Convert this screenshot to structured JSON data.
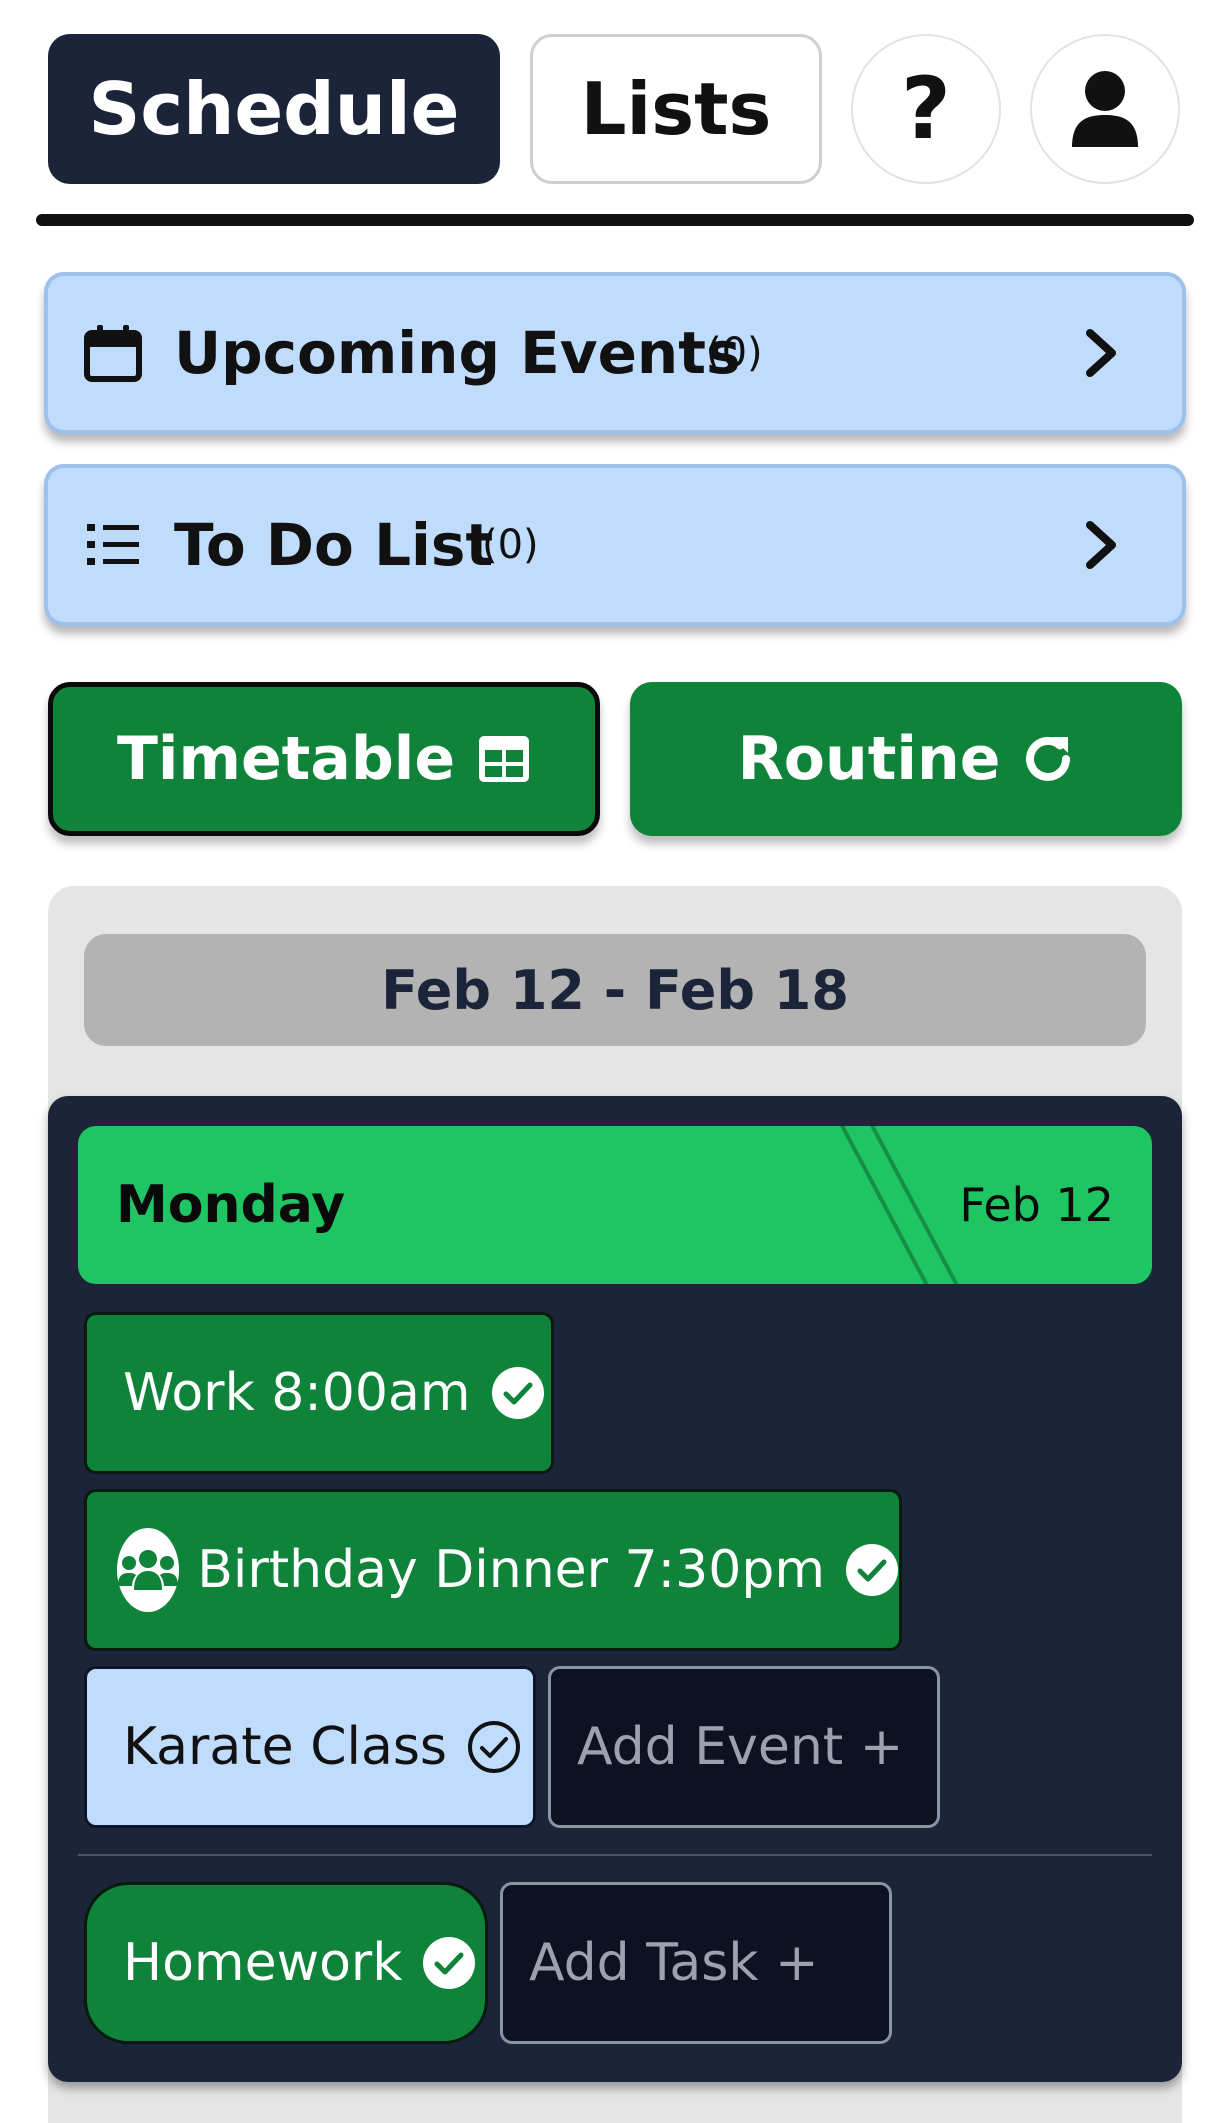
{
  "nav": {
    "schedule_label": "Schedule",
    "lists_label": "Lists",
    "help_label": "?",
    "user_icon": "user-icon",
    "active_tab": "Schedule"
  },
  "cards": {
    "upcoming": {
      "title": "Upcoming Events",
      "count": "(0)",
      "icon": "calendar-icon"
    },
    "todo": {
      "title": "To Do List",
      "count": "(0)",
      "icon": "list-icon"
    }
  },
  "actions": {
    "timetable_label": "Timetable",
    "timetable_icon": "table-icon",
    "routine_label": "Routine",
    "routine_icon": "refresh-icon"
  },
  "week": {
    "range": "Feb 12 - Feb 18",
    "day": {
      "name": "Monday",
      "date": "Feb 12",
      "events": [
        {
          "label": "Work 8:00am",
          "status": "completed",
          "style": "green"
        },
        {
          "label": "Birthday Dinner 7:30pm",
          "status": "completed",
          "style": "green",
          "icon": "group-icon"
        },
        {
          "label": "Karate Class",
          "status": "pending",
          "style": "light"
        }
      ],
      "add_event_label": "Add Event +",
      "tasks": [
        {
          "label": "Homework",
          "status": "completed",
          "style": "green"
        }
      ],
      "add_task_label": "Add Task +"
    }
  },
  "colors": {
    "navy": "#1b2439",
    "card_blue": "#c0dcfd",
    "action_green": "#0f833a",
    "day_header_green": "#1fc562",
    "panel_gray": "#e5e5e5",
    "range_gray": "#b3b3b3"
  }
}
